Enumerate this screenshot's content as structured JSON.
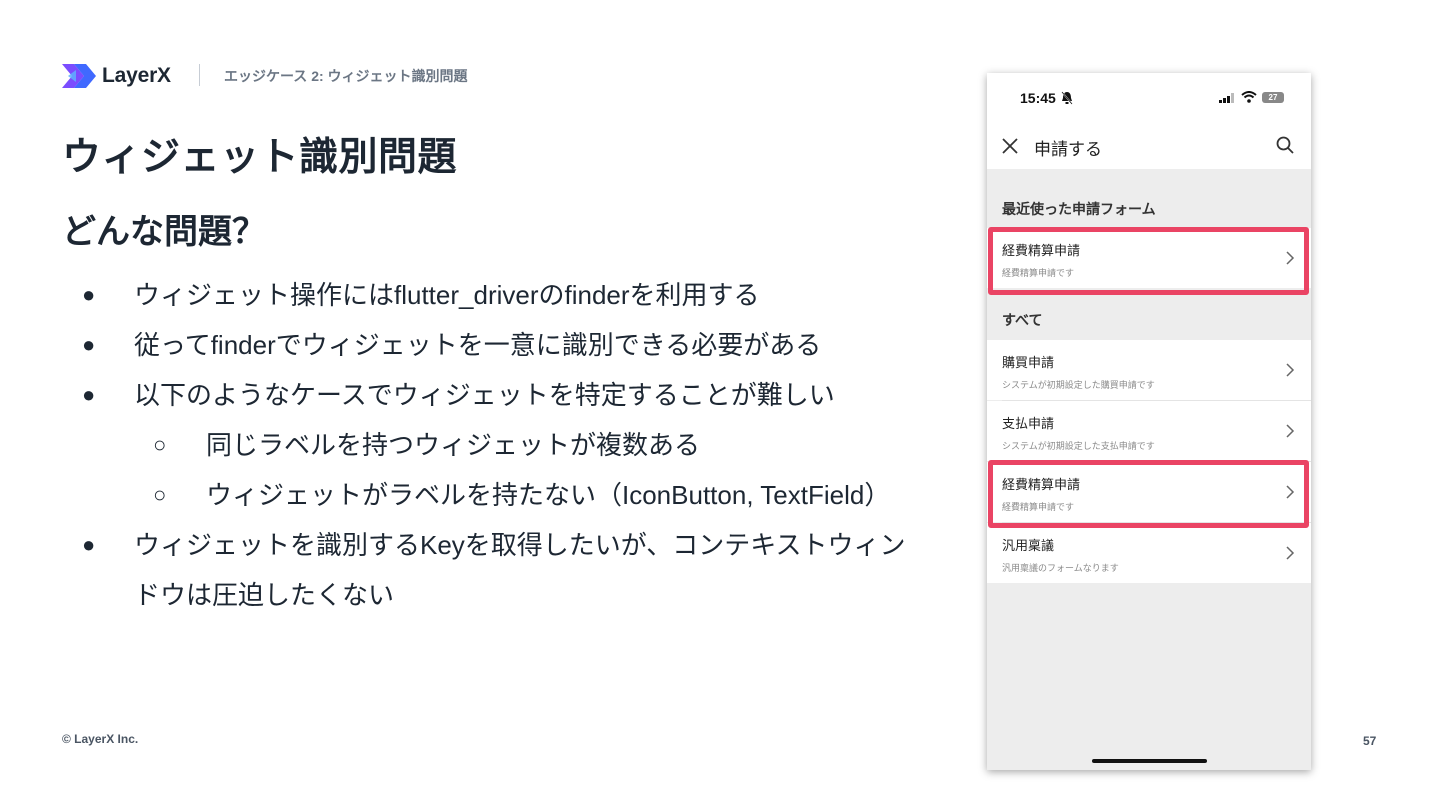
{
  "header": {
    "logo_text": "LayerX",
    "breadcrumb": "エッジケース 2: ウィジェット識別問題"
  },
  "title": "ウィジェット識別問題",
  "subtitle": "どんな問題？",
  "bullets": {
    "b1": "ウィジェット操作にはflutter_driverのfinderを利用する",
    "b2": "従ってfinderでウィジェットを一意に識別できる必要がある",
    "b3": "以下のようなケースでウィジェットを特定することが難しい",
    "b3_1": "同じラベルを持つウィジェットが複数ある",
    "b3_2": "ウィジェットがラベルを持たない（IconButton, TextField）",
    "b4_line1": "ウィジェットを識別するKeyを取得したいが、コンテキストウィン",
    "b4_line2": "ドウは圧迫したくない",
    "filled_marker": "●",
    "hollow_marker": "○"
  },
  "footer": {
    "copyright": "© LayerX Inc.",
    "page_number": "57"
  },
  "phone": {
    "status_time": "15:45",
    "battery": "27",
    "app_title": "申請する",
    "section_recent": "最近使った申請フォーム",
    "section_all": "すべて",
    "items": [
      {
        "title": "経費精算申請",
        "subtitle": "経費精算申請です"
      },
      {
        "title": "購買申請",
        "subtitle": "システムが初期設定した購買申請です"
      },
      {
        "title": "支払申請",
        "subtitle": "システムが初期設定した支払申請です"
      },
      {
        "title": "経費精算申請",
        "subtitle": "経費精算申請です"
      },
      {
        "title": "汎用稟議",
        "subtitle": "汎用稟議のフォームなります"
      }
    ]
  },
  "colors": {
    "text": "#1d2733",
    "muted": "#6b7684",
    "highlight": "#ea4464",
    "logo_blue": "#2b59ff",
    "logo_purple": "#7b4dff"
  }
}
